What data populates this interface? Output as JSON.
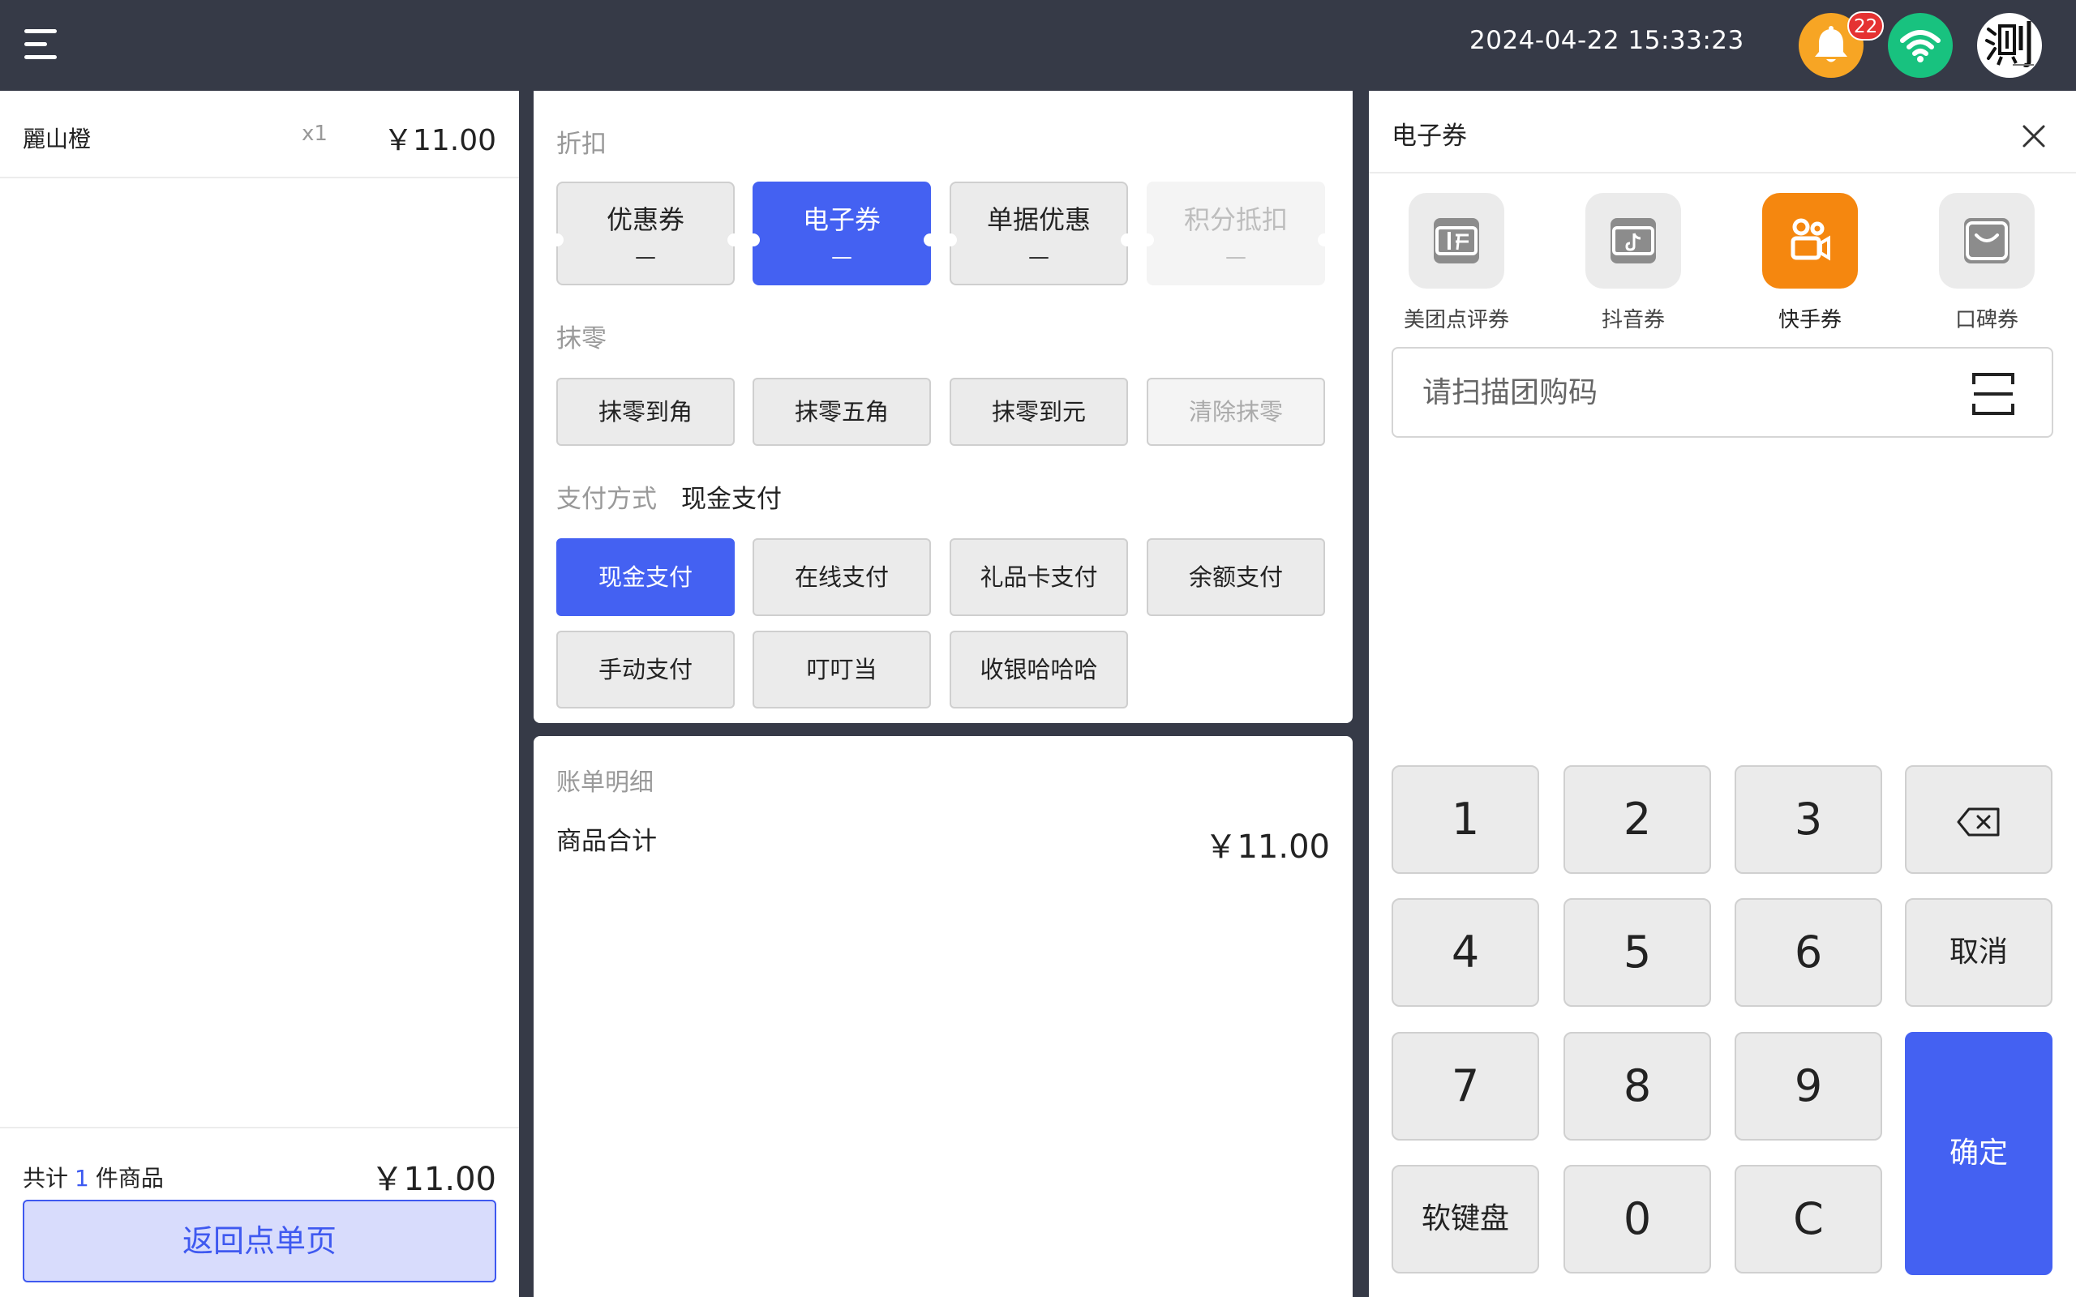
{
  "topbar": {
    "datetime": "2024-04-22 15:33:23",
    "notification_count": "22",
    "icons": [
      "menu-icon",
      "bell-icon",
      "wifi-icon",
      "avatar"
    ],
    "colors": {
      "bell": "#f7a524",
      "wifi": "#18c27f"
    }
  },
  "order": {
    "items": [
      {
        "name": "麗山橙",
        "qty": "x1",
        "price": "￥11.00"
      }
    ],
    "footer": {
      "prefix": "共计",
      "count": "1",
      "suffix": "件商品",
      "total": "￥11.00"
    },
    "back_label": "返回点单页"
  },
  "discount": {
    "label": "折扣",
    "coupons": [
      {
        "label": "优惠券",
        "value": "—"
      },
      {
        "label": "电子券",
        "value": "—"
      },
      {
        "label": "单据优惠",
        "value": "—"
      },
      {
        "label": "积分抵扣",
        "value": "—"
      }
    ]
  },
  "rounding": {
    "label": "抹零",
    "options": [
      "抹零到角",
      "抹零五角",
      "抹零到元",
      "清除抹零"
    ]
  },
  "payment": {
    "label": "支付方式",
    "current": "现金支付",
    "methods": [
      "现金支付",
      "在线支付",
      "礼品卡支付",
      "余额支付",
      "手动支付",
      "叮叮当",
      "收银哈哈哈"
    ]
  },
  "bill": {
    "title": "账单明细",
    "rows": [
      {
        "label": "商品合计",
        "value": "￥11.00"
      }
    ]
  },
  "ecoupon": {
    "title": "电子券",
    "platforms": [
      {
        "name": "美团点评券",
        "icon": "meituan-icon"
      },
      {
        "name": "抖音券",
        "icon": "douyin-icon"
      },
      {
        "name": "快手券",
        "icon": "kuaishou-icon"
      },
      {
        "name": "口碑券",
        "icon": "koubei-icon"
      }
    ],
    "selected_platform": "快手券",
    "scan_placeholder": "请扫描团购码",
    "scan_value": "",
    "keypad": {
      "keys": [
        "1",
        "2",
        "3",
        "4",
        "5",
        "6",
        "7",
        "8",
        "9",
        "软键盘",
        "0",
        "C"
      ],
      "cancel": "取消",
      "confirm": "确定"
    },
    "accent_color": "#4461f2",
    "selected_color": "#f5870f"
  }
}
